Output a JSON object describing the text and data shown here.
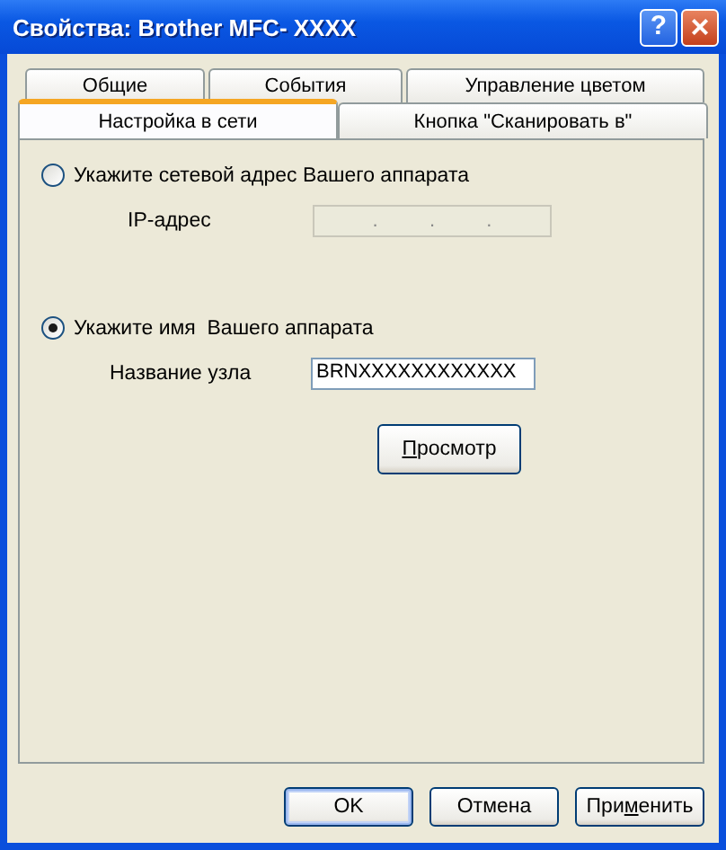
{
  "window": {
    "title": "Свойства: Brother MFC- XXXX",
    "help_button": "?",
    "close_button": "×"
  },
  "back_tabs": [
    {
      "label": "Общие",
      "selected": false
    },
    {
      "label": "События",
      "selected": false
    },
    {
      "label": "Управление цветом",
      "selected": false
    }
  ],
  "front_tabs": [
    {
      "label": "Настройка в сети",
      "selected": true
    },
    {
      "label": "Кнопка \"Сканировать в\"",
      "selected": false
    }
  ],
  "options": [
    {
      "label": "Укажите сетевой адрес Вашего аппарата",
      "selected": false,
      "field_label": "IP-адрес",
      "kind": "ip",
      "disabled": true,
      "separators": [
        ".",
        ".",
        "."
      ]
    },
    {
      "label": "Укажите имя  Вашего аппарата",
      "selected": true,
      "field_label": "Название узла",
      "kind": "text",
      "disabled": false,
      "value": "BRNXXXXXXXXXXXX"
    }
  ],
  "browse_button": {
    "mnemonic": "П",
    "rest": "росмотр"
  },
  "buttons": [
    {
      "lead": "OK",
      "default": true
    },
    {
      "lead": "Отмена",
      "default": false
    },
    {
      "lead": "При",
      "mnemonic": "м",
      "rest": "енить",
      "default": false
    }
  ]
}
